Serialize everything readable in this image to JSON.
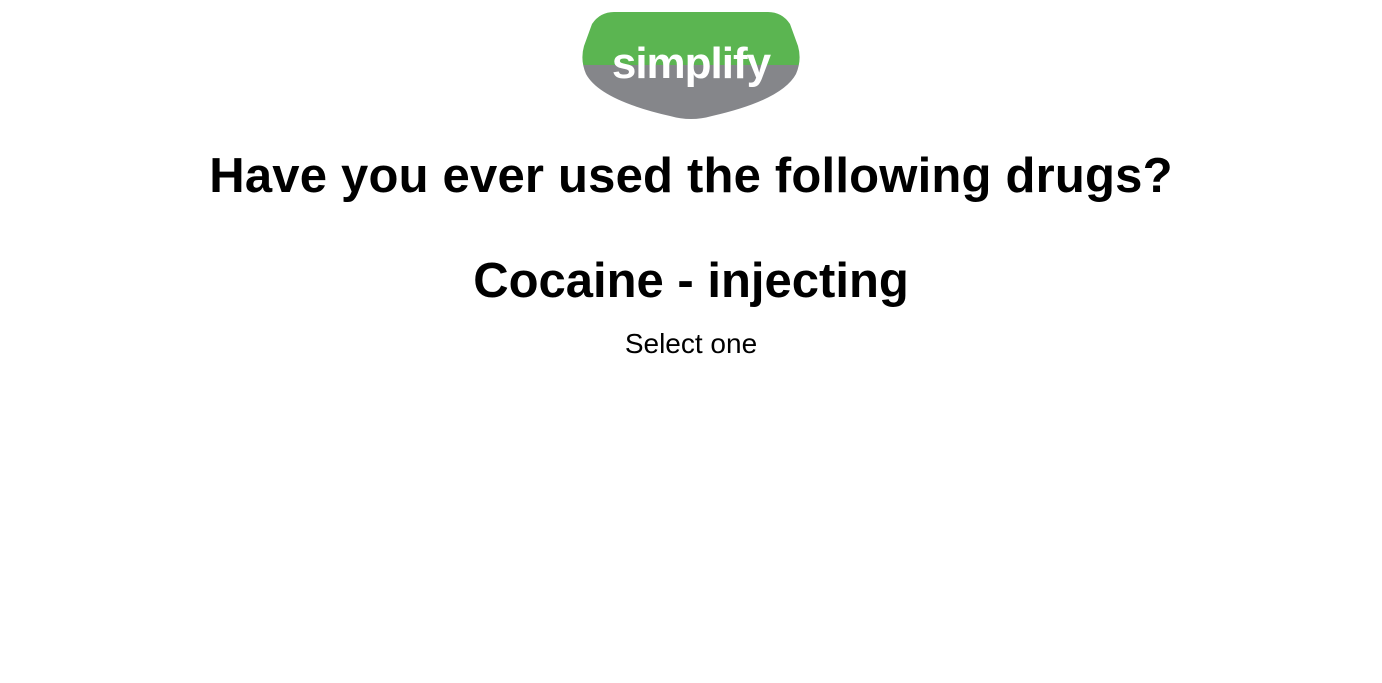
{
  "logo": {
    "text": "simplify",
    "colors": {
      "top": "#5bb551",
      "bottom": "#85868a",
      "text": "#ffffff"
    }
  },
  "question": {
    "title": "Have you ever used the following drugs?",
    "item": "Cocaine - injecting",
    "instruction": "Select one"
  }
}
